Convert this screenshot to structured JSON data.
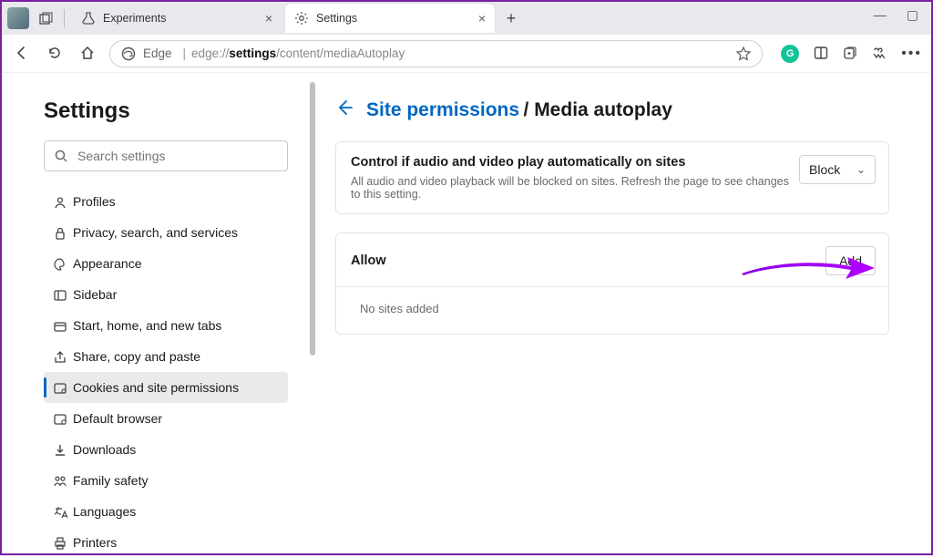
{
  "tabs": [
    {
      "title": "Experiments",
      "favicon": "flask"
    },
    {
      "title": "Settings",
      "favicon": "gear"
    }
  ],
  "toolbar": {
    "edge_label": "Edge",
    "url_prefix": "edge://",
    "url_bold": "settings",
    "url_suffix": "/content/mediaAutoplay"
  },
  "sidebar": {
    "title": "Settings",
    "search_placeholder": "Search settings",
    "items": [
      {
        "label": "Profiles"
      },
      {
        "label": "Privacy, search, and services"
      },
      {
        "label": "Appearance"
      },
      {
        "label": "Sidebar"
      },
      {
        "label": "Start, home, and new tabs"
      },
      {
        "label": "Share, copy and paste"
      },
      {
        "label": "Cookies and site permissions"
      },
      {
        "label": "Default browser"
      },
      {
        "label": "Downloads"
      },
      {
        "label": "Family safety"
      },
      {
        "label": "Languages"
      },
      {
        "label": "Printers"
      }
    ],
    "selected_index": 6
  },
  "breadcrumb": {
    "parent": "Site permissions",
    "current": "Media autoplay"
  },
  "control_card": {
    "title": "Control if audio and video play automatically on sites",
    "desc": "All audio and video playback will be blocked on sites. Refresh the page to see changes to this setting.",
    "dropdown_value": "Block"
  },
  "allow_card": {
    "title": "Allow",
    "add_label": "Add",
    "empty_text": "No sites added"
  }
}
